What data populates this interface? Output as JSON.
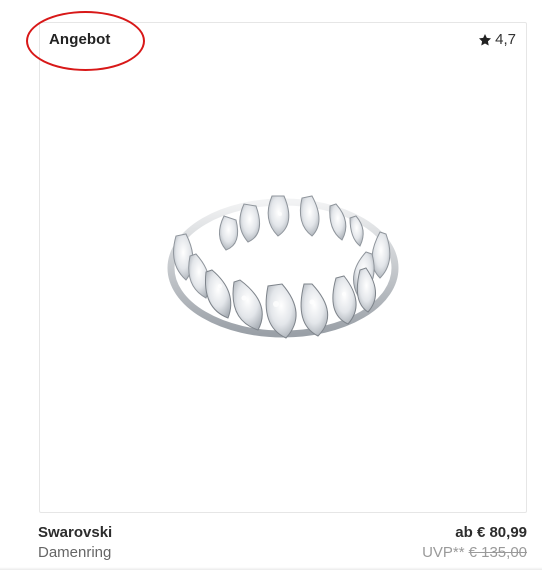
{
  "product": {
    "badge": "Angebot",
    "rating": "4,7",
    "brand": "Swarovski",
    "type": "Damenring",
    "price": "ab € 80,99",
    "uvp_label": "UVP**",
    "old_price": "€ 135,00",
    "image_alt": "Swarovski Damenring"
  },
  "icons": {
    "rating": "star-icon"
  },
  "colors": {
    "annotation": "#d81818",
    "border": "#e6e6e6"
  }
}
